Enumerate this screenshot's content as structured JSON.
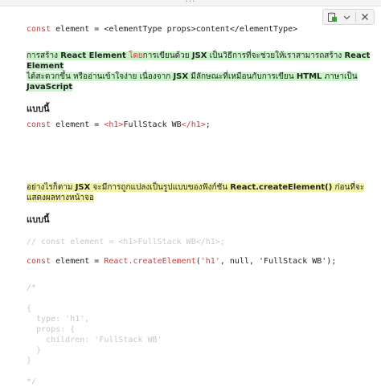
{
  "window": {
    "dots": "..."
  },
  "toolbar": {
    "icons": [
      "paste-format-icon",
      "chevron-down-icon",
      "close-icon"
    ]
  },
  "line1": {
    "kw": "const",
    "rest": " element = <elementType props>content</elementType>"
  },
  "para1": {
    "line_a": [
      "การสร้าง ",
      "React Element",
      " โดย",
      "การเขียนด้วย ",
      "JSX",
      " เป็นวิธีการที่จะช่วยให้เราสามารถสร้าง ",
      "React Element"
    ],
    "line_b": [
      "ได้สะดวกขึ้น หรืออ่านเข้าใจง่าย เนื่องจาก ",
      "JSX",
      " มีลักษณะที่เหมือนกับการเขียน ",
      "HTML",
      " ภาษาเป็น ",
      "JavaScript"
    ]
  },
  "heading1": "แบบนี้",
  "line2": {
    "kw": "const",
    "mid": " element = ",
    "open_tag": "<h1>",
    "text": "FullStack WB",
    "close_tag": "</h1>",
    "end": ";"
  },
  "para2": [
    "อย่างไรก็ตาม ",
    "JSX",
    " จะมีการถูกแปลงเป็นรูปแบบของฟังก์ชัน ",
    "React.createElement()",
    " ก่อนที่จะแสดงผลทางหน้าจอ"
  ],
  "heading2": "แบบนี้",
  "comment1": "// const element = <h1>FullStack WB</h1>;",
  "line3": {
    "kw": "const",
    "mid": " element = ",
    "fn": "React.createElement",
    "args_open": "(",
    "arg1": "'h1'",
    "arg_rest": ", null, 'FullStack WB');"
  },
  "comment_block": [
    "/*",
    "",
    "{",
    "  type: 'h1',",
    "  props: {",
    "    children: 'FullStack WB'",
    "  }",
    "}",
    "",
    "*/"
  ]
}
